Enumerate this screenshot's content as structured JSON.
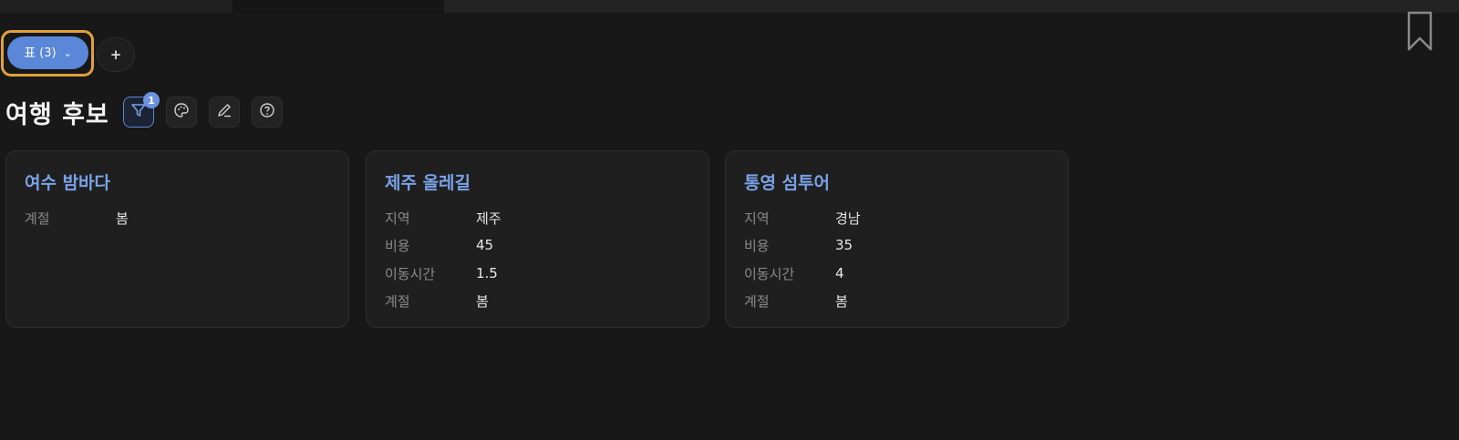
{
  "view_switcher": {
    "label": "표",
    "count": "(3)",
    "chevron": "⌄"
  },
  "add_view_label": "+",
  "page_title": "여행 후보",
  "toolbar": {
    "filter_badge": "1",
    "icons": [
      "filter-icon",
      "palette-icon",
      "pencil-icon",
      "help-icon"
    ]
  },
  "cards": [
    {
      "title": "여수 밤바다",
      "props": [
        {
          "label": "계절",
          "value": "봄"
        }
      ]
    },
    {
      "title": "제주 올레길",
      "props": [
        {
          "label": "지역",
          "value": "제주"
        },
        {
          "label": "비용",
          "value": "45"
        },
        {
          "label": "이동시간",
          "value": "1.5"
        },
        {
          "label": "계절",
          "value": "봄"
        }
      ]
    },
    {
      "title": "통영 섬투어",
      "props": [
        {
          "label": "지역",
          "value": "경남"
        },
        {
          "label": "비용",
          "value": "35"
        },
        {
          "label": "이동시간",
          "value": "4"
        },
        {
          "label": "계절",
          "value": "봄"
        }
      ]
    }
  ],
  "colors": {
    "accent": "#5b87d9",
    "focus_ring": "#e0a13a",
    "card_title": "#7aa2e8",
    "background": "#181818"
  }
}
